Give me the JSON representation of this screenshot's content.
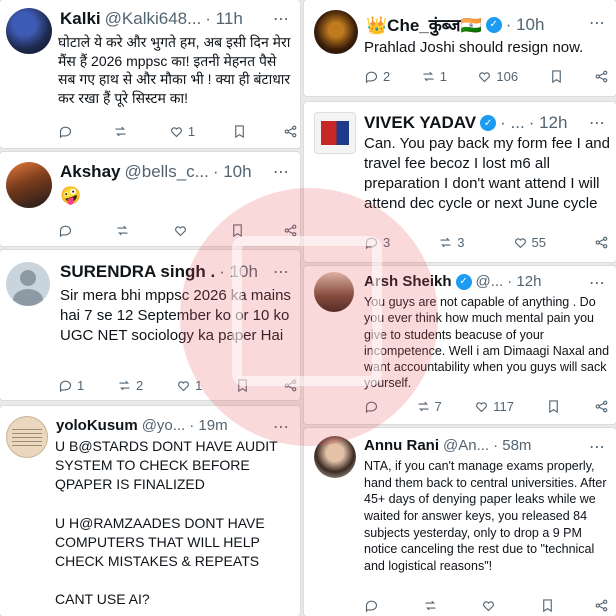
{
  "tweets": [
    {
      "name": "Kalki",
      "handle": "@Kalki648...",
      "time": "· 11h",
      "text": "घोटाले ये करे और भुगते हम, अब इसी दिन मेरा मैंस हैं 2026 mppsc का! इतनी मेहनत पैसे सब गए हाथ से और मौका भी ! क्या ही बंटाधार कर रखा हैं पूरे सिस्टम का!",
      "reply": "",
      "retweet": "",
      "like": "1",
      "views": ""
    },
    {
      "name": "Akshay",
      "handle": "@bells_c...",
      "time": "· 10h",
      "text": "🤪",
      "reply": "",
      "retweet": "",
      "like": "",
      "views": ""
    },
    {
      "name": "SURENDRA singh .",
      "handle": "",
      "time": "· 10h",
      "text": "Sir mera bhi mppsc 2026 ka mains hai 7 se 12 September ko or 10 ko UGC NET sociology ka paper Hai",
      "reply": "1",
      "retweet": "2",
      "like": "1",
      "views": ""
    },
    {
      "name": "yoloKusum",
      "handle": "@yo...",
      "time": "· 19m",
      "text": "U B@STARDS DONT HAVE AUDIT SYSTEM TO CHECK BEFORE QPAPER IS FINALIZED\n\nU H@RAMZAADES DONT HAVE COMPUTERS THAT WILL HELP CHECK MISTAKES & REPEATS\n\nCANT USE AI?",
      "reply": "",
      "retweet": "",
      "like": "",
      "views": ""
    },
    {
      "name": "👑Che_कुंब्ज🇮🇳",
      "handle": "",
      "time": "· 10h",
      "text": "Prahlad Joshi should resign now.",
      "reply": "2",
      "retweet": "1",
      "like": "106",
      "views": ""
    },
    {
      "name": "VIVEK YADAV",
      "handle": "· ...",
      "time": "· 12h",
      "text": "Can. You pay back my form fee I and travel fee becoz I lost m6 all preparation I don't want attend I will attend dec cycle or next June cycle",
      "reply": "3",
      "retweet": "3",
      "like": "55",
      "views": ""
    },
    {
      "name": "Arsh Sheikh",
      "handle": "@...",
      "time": "· 12h",
      "text": "You guys are not capable of anything . Do you ever think how much mental pain you give to students beacuse of your incompetence. Well i am Dimaagi Naxal and want accountability when you guys will sack yourself.",
      "reply": "",
      "retweet": "7",
      "like": "117",
      "views": ""
    },
    {
      "name": "Annu Rani",
      "handle": "@An...",
      "time": "· 58m",
      "text": "NTA, if you can't manage exams properly, hand them back to central universities. After 45+ days of denying paper leaks while we waited for answer keys, you released 84 subjects yesterday, only to drop a 9 PM notice canceling the rest due to \"technical and logistical reasons\"!",
      "reply": "",
      "retweet": "",
      "like": "",
      "views": ""
    }
  ],
  "colors": {
    "accent": "#1d9bf0",
    "muted": "#536471",
    "watermark": "#e6505a"
  },
  "icons": [
    "reply-icon",
    "retweet-icon",
    "like-icon",
    "bookmark-icon",
    "share-icon",
    "verified-badge-icon",
    "more-icon"
  ]
}
